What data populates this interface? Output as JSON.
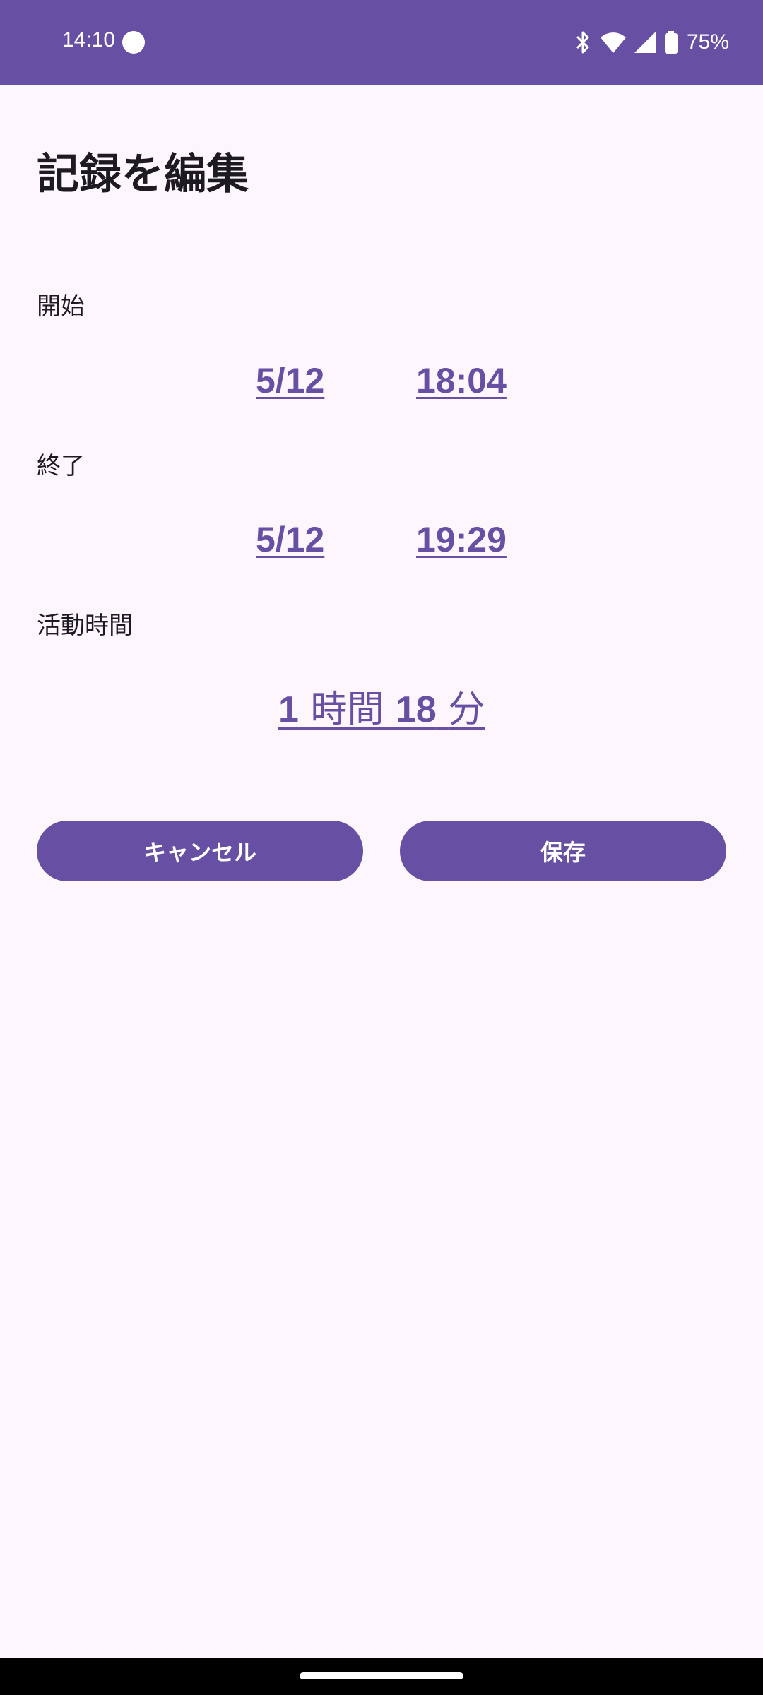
{
  "status_bar": {
    "time": "14:10",
    "battery": "75%",
    "icons": [
      "bluetooth-icon",
      "wifi-icon",
      "signal-icon",
      "battery-icon"
    ]
  },
  "page": {
    "title": "記録を編集"
  },
  "start": {
    "label": "開始",
    "date": "5/12",
    "time": "18:04"
  },
  "end": {
    "label": "終了",
    "date": "5/12",
    "time": "19:29"
  },
  "duration": {
    "label": "活動時間",
    "hours": "1",
    "hours_unit": "時間",
    "minutes": "18",
    "minutes_unit": "分"
  },
  "actions": {
    "cancel_label": "キャンセル",
    "save_label": "保存"
  },
  "colors": {
    "accent": "#6750a4",
    "background": "#fdf7fd",
    "text": "#1d1b20"
  }
}
